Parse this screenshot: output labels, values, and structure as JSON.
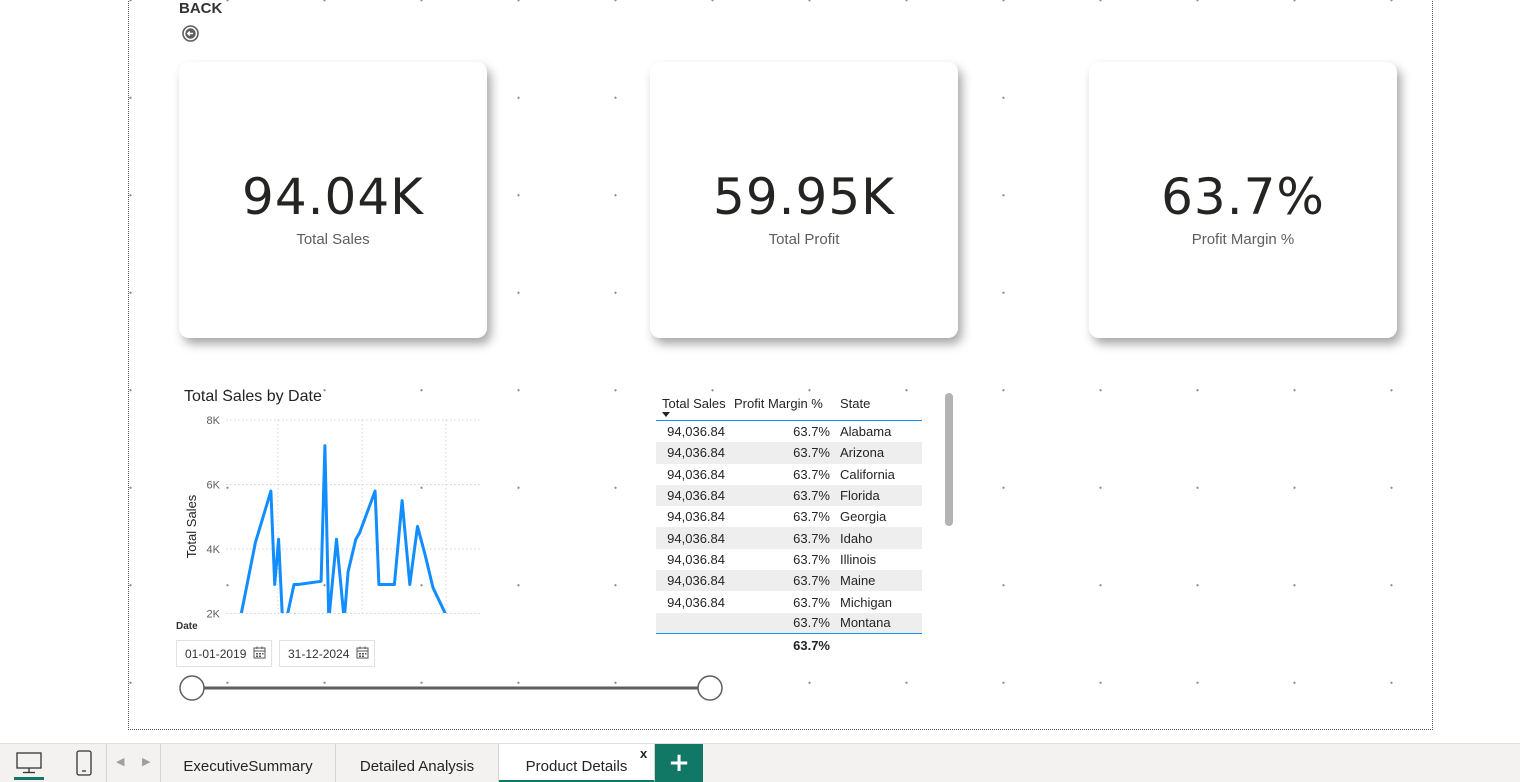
{
  "back": {
    "label": "BACK",
    "icon": "back-arrow-icon"
  },
  "cards": [
    {
      "value": "94.04K",
      "label": "Total Sales"
    },
    {
      "value": "59.95K",
      "label": "Total Profit"
    },
    {
      "value": "63.7%",
      "label": "Profit Margin %"
    }
  ],
  "chart_data": {
    "type": "line",
    "title": "Total Sales by Date",
    "xlabel": "",
    "ylabel": "Total Sales",
    "y_ticks": [
      "8K",
      "6K",
      "4K",
      "2K"
    ],
    "ylim": [
      1800,
      8000
    ],
    "grid": true,
    "color": "#118dff",
    "x": [
      0,
      4,
      8,
      9,
      10,
      11,
      12,
      14,
      15,
      21,
      22,
      23,
      25,
      27,
      28,
      30,
      31,
      35,
      36,
      40,
      42,
      44,
      46,
      48,
      50,
      52,
      54,
      56,
      57
    ],
    "values": [
      1800,
      4200,
      5800,
      2900,
      4300,
      1800,
      1800,
      2900,
      2900,
      3000,
      7200,
      1800,
      4300,
      1800,
      3300,
      4300,
      4500,
      5800,
      2900,
      2900,
      5500,
      2900,
      4700,
      3800,
      2800,
      2300,
      1800,
      1800,
      1800
    ]
  },
  "slicer": {
    "title": "Date",
    "start": "01-01-2019",
    "end": "31-12-2024",
    "calendar_icon": "calendar-icon"
  },
  "table": {
    "headers": [
      "Total Sales",
      "Profit Margin %",
      "State"
    ],
    "rows": [
      [
        "94,036.84",
        "63.7%",
        "Alabama"
      ],
      [
        "94,036.84",
        "63.7%",
        "Arizona"
      ],
      [
        "94,036.84",
        "63.7%",
        "California"
      ],
      [
        "94,036.84",
        "63.7%",
        "Florida"
      ],
      [
        "94,036.84",
        "63.7%",
        "Georgia"
      ],
      [
        "94,036.84",
        "63.7%",
        "Idaho"
      ],
      [
        "94,036.84",
        "63.7%",
        "Illinois"
      ],
      [
        "94,036.84",
        "63.7%",
        "Maine"
      ],
      [
        "94,036.84",
        "63.7%",
        "Michigan"
      ],
      [
        "",
        "63.7%",
        "Montana"
      ]
    ],
    "total": [
      "",
      "63.7%",
      ""
    ]
  },
  "tabs": [
    {
      "label": "ExecutiveSummary",
      "active": false
    },
    {
      "label": "Detailed Analysis",
      "active": false
    },
    {
      "label": "Product Details",
      "active": true
    }
  ],
  "tab_close": "x",
  "add_tab": "+",
  "nav": {
    "prev": "◀",
    "next": "▶"
  },
  "colors": {
    "accent": "#117865",
    "line": "#118dff"
  }
}
